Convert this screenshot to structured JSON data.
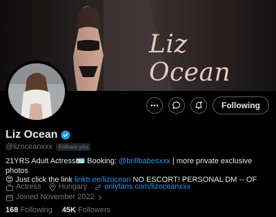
{
  "banner": {
    "title": "Liz Ocean"
  },
  "actions": {
    "more_icon": "more-horizontal-icon",
    "message_icon": "message-icon",
    "notify_icon": "notification-bell-icon",
    "follow_label": "Following"
  },
  "profile": {
    "name": "Liz Ocean",
    "verified_color": "#1d9bf0",
    "handle": "@lizoceanxxx",
    "follows_you": "Follows you",
    "bio": {
      "line1_prefix": "21YRS Adult Actress🪪 Booking: ",
      "booking_link": "@brillbabesxxx",
      "line1_suffix": " | more private exclusive photos",
      "line2_prefix": "😍 Just click the link ",
      "link": "linktr.ee/lizocean",
      "line2_suffix": " NO ESCORT! PERSONAL DM -- OF"
    },
    "category": "Actress",
    "location": "Hungary",
    "website": "onlyfans.com/lizoceanxxx",
    "joined": "Joined November 2022",
    "following_count": "168",
    "following_label": "Following",
    "followers_count": "45K",
    "followers_label": "Followers"
  },
  "colors": {
    "accent": "#1d9bf0",
    "muted": "#71767b",
    "text": "#e7e9ea"
  }
}
